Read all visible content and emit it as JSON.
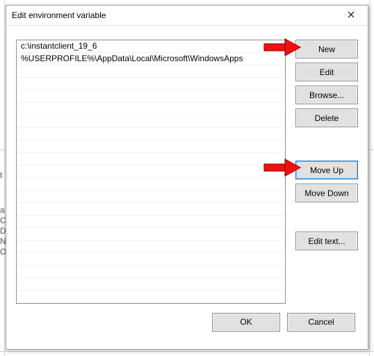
{
  "dialog": {
    "title": "Edit environment variable"
  },
  "list": {
    "items": [
      "c:\\instantclient_19_6",
      "%USERPROFILE%\\AppData\\Local\\Microsoft\\WindowsApps"
    ]
  },
  "buttons": {
    "new": "New",
    "edit": "Edit",
    "browse": "Browse...",
    "delete": "Delete",
    "move_up": "Move Up",
    "move_down": "Move Down",
    "edit_text": "Edit text...",
    "ok": "OK",
    "cancel": "Cancel"
  },
  "annotations": {
    "arrow_new": "callout-arrow",
    "arrow_moveup": "callout-arrow"
  }
}
